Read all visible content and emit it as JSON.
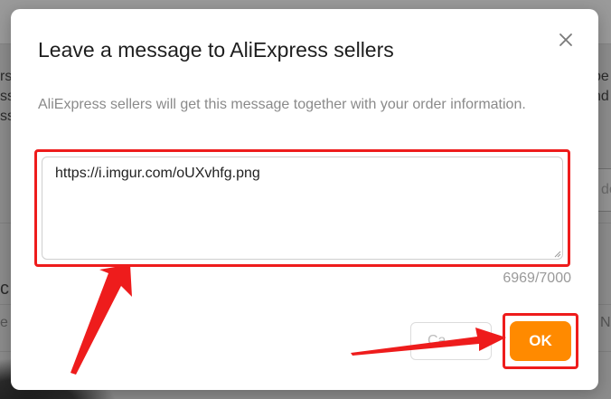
{
  "modal": {
    "title": "Leave a message to AliExpress sellers",
    "description": "AliExpress sellers will get this message together with your order information.",
    "message_value": "https://i.imgur.com/oUXvhfg.png",
    "char_count": "6969/7000",
    "cancel_label": "Ca",
    "ok_label": "OK"
  },
  "background": {
    "left_fragments": [
      "rs",
      "ss",
      "ss"
    ],
    "right_fragments": [
      "be",
      "nd"
    ],
    "right_input_fragment": "de",
    "left_row_fragment": "c",
    "left_row2_fragment": "e:",
    "right_row2_fragment": "N"
  },
  "colors": {
    "accent": "#ff8a00",
    "annotation": "#ee1c1c",
    "title_text": "#1e1e1e",
    "muted_text": "#8a8a8a"
  },
  "icons": {
    "close": "close-icon"
  }
}
